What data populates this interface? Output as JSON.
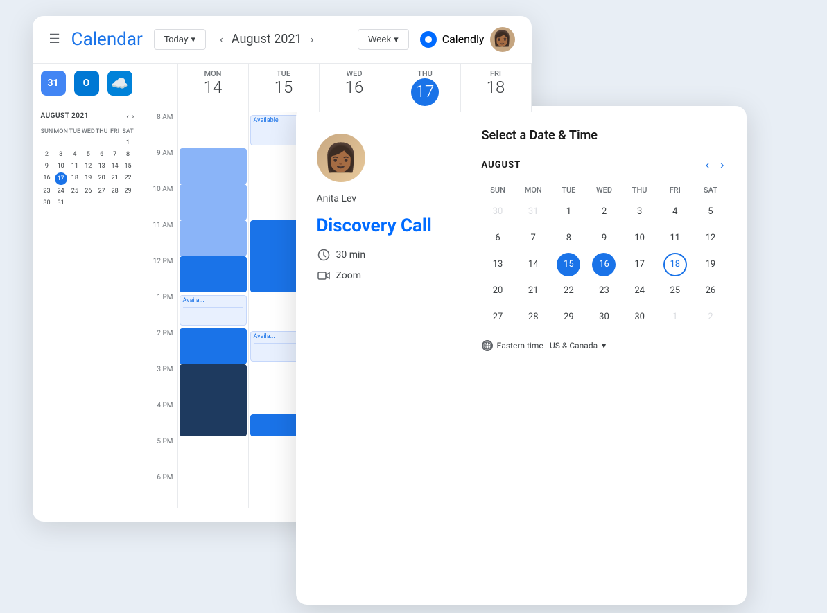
{
  "calendar": {
    "title": "Calendar",
    "today_btn": "Today",
    "month": "August 2021",
    "nav_prev": "‹",
    "nav_next": "›",
    "week_btn": "Week",
    "calendly_label": "Calendly",
    "header_icons": {
      "hamburger": "☰"
    },
    "mini_cal": {
      "title": "AUGUST 2021",
      "day_headers": [
        "SUN",
        "MON",
        "TUE",
        "WED",
        "THU",
        "FRI",
        "SAT"
      ],
      "days": [
        {
          "n": "",
          "cls": ""
        },
        {
          "n": "",
          "cls": ""
        },
        {
          "n": "",
          "cls": ""
        },
        {
          "n": "",
          "cls": ""
        },
        {
          "n": "",
          "cls": ""
        },
        {
          "n": "",
          "cls": ""
        },
        {
          "n": "1",
          "cls": ""
        },
        {
          "n": "2",
          "cls": ""
        },
        {
          "n": "3",
          "cls": ""
        },
        {
          "n": "4",
          "cls": ""
        },
        {
          "n": "5",
          "cls": ""
        },
        {
          "n": "6",
          "cls": ""
        },
        {
          "n": "7",
          "cls": ""
        },
        {
          "n": "8",
          "cls": ""
        },
        {
          "n": "9",
          "cls": ""
        },
        {
          "n": "10",
          "cls": ""
        },
        {
          "n": "11",
          "cls": ""
        },
        {
          "n": "12",
          "cls": ""
        },
        {
          "n": "13",
          "cls": ""
        },
        {
          "n": "14",
          "cls": ""
        },
        {
          "n": "15",
          "cls": ""
        },
        {
          "n": "16",
          "cls": ""
        },
        {
          "n": "17",
          "cls": "today"
        },
        {
          "n": "18",
          "cls": ""
        },
        {
          "n": "19",
          "cls": ""
        },
        {
          "n": "20",
          "cls": ""
        },
        {
          "n": "21",
          "cls": ""
        },
        {
          "n": "22",
          "cls": ""
        },
        {
          "n": "23",
          "cls": ""
        },
        {
          "n": "24",
          "cls": ""
        },
        {
          "n": "25",
          "cls": ""
        },
        {
          "n": "26",
          "cls": ""
        },
        {
          "n": "27",
          "cls": ""
        },
        {
          "n": "28",
          "cls": ""
        },
        {
          "n": "29",
          "cls": ""
        },
        {
          "n": "30",
          "cls": ""
        },
        {
          "n": "31",
          "cls": ""
        }
      ]
    },
    "week_days": [
      {
        "name": "MON",
        "num": "14",
        "is_today": false
      },
      {
        "name": "TUE",
        "num": "15",
        "is_today": false
      },
      {
        "name": "WED",
        "num": "16",
        "is_today": false
      },
      {
        "name": "THU",
        "num": "17",
        "is_today": true
      },
      {
        "name": "FRI",
        "num": "18",
        "is_today": false
      }
    ],
    "time_labels": [
      "8 AM",
      "9 AM",
      "10 AM",
      "11 AM",
      "12 PM",
      "1 PM",
      "2 PM",
      "3 PM",
      "4 PM",
      "5 PM",
      "6 PM"
    ]
  },
  "booking": {
    "person_name": "Anita Lev",
    "event_title": "Discovery Call",
    "duration": "30 min",
    "meeting_type": "Zoom",
    "select_title": "Select a Date & Time",
    "month": "AUGUST",
    "nav_prev": "‹",
    "nav_next": "›",
    "day_headers": [
      "SUN",
      "MON",
      "TUE",
      "WED",
      "THU",
      "FRI",
      "SAT"
    ],
    "calendar_rows": [
      [
        {
          "n": "30",
          "cls": "inactive"
        },
        {
          "n": "31",
          "cls": "inactive"
        },
        {
          "n": "1",
          "cls": ""
        },
        {
          "n": "2",
          "cls": ""
        },
        {
          "n": "3",
          "cls": ""
        },
        {
          "n": "4",
          "cls": ""
        },
        {
          "n": "5",
          "cls": ""
        }
      ],
      [
        {
          "n": "6",
          "cls": ""
        },
        {
          "n": "7",
          "cls": ""
        },
        {
          "n": "8",
          "cls": ""
        },
        {
          "n": "9",
          "cls": ""
        },
        {
          "n": "10",
          "cls": ""
        },
        {
          "n": "11",
          "cls": ""
        },
        {
          "n": "12",
          "cls": ""
        }
      ],
      [
        {
          "n": "13",
          "cls": ""
        },
        {
          "n": "14",
          "cls": ""
        },
        {
          "n": "15",
          "cls": "highlighted"
        },
        {
          "n": "16",
          "cls": "highlighted"
        },
        {
          "n": "17",
          "cls": ""
        },
        {
          "n": "18",
          "cls": "circled"
        },
        {
          "n": "19",
          "cls": ""
        }
      ],
      [
        {
          "n": "20",
          "cls": ""
        },
        {
          "n": "21",
          "cls": ""
        },
        {
          "n": "22",
          "cls": ""
        },
        {
          "n": "23",
          "cls": ""
        },
        {
          "n": "24",
          "cls": ""
        },
        {
          "n": "25",
          "cls": ""
        },
        {
          "n": "26",
          "cls": ""
        }
      ],
      [
        {
          "n": "27",
          "cls": ""
        },
        {
          "n": "28",
          "cls": ""
        },
        {
          "n": "29",
          "cls": ""
        },
        {
          "n": "30",
          "cls": ""
        },
        {
          "n": "30",
          "cls": ""
        },
        {
          "n": "1",
          "cls": "inactive"
        },
        {
          "n": "2",
          "cls": "inactive"
        }
      ]
    ],
    "timezone": "Eastern time - US & Canada"
  }
}
